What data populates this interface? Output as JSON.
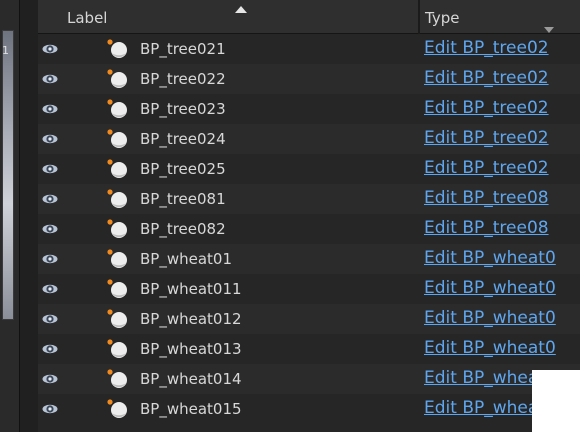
{
  "header": {
    "label_col": "Label",
    "type_col": "Type"
  },
  "left_strip_text": "1",
  "rows": [
    {
      "label": "BP_tree021",
      "type": "Edit BP_tree02"
    },
    {
      "label": "BP_tree022",
      "type": "Edit BP_tree02"
    },
    {
      "label": "BP_tree023",
      "type": "Edit BP_tree02"
    },
    {
      "label": "BP_tree024",
      "type": "Edit BP_tree02"
    },
    {
      "label": "BP_tree025",
      "type": "Edit BP_tree02"
    },
    {
      "label": "BP_tree081",
      "type": "Edit BP_tree08"
    },
    {
      "label": "BP_tree082",
      "type": "Edit BP_tree08"
    },
    {
      "label": "BP_wheat01",
      "type": "Edit BP_wheat0"
    },
    {
      "label": "BP_wheat011",
      "type": "Edit BP_wheat0"
    },
    {
      "label": "BP_wheat012",
      "type": "Edit BP_wheat0"
    },
    {
      "label": "BP_wheat013",
      "type": "Edit BP_wheat0"
    },
    {
      "label": "BP_wheat014",
      "type": "Edit BP_wheat0"
    },
    {
      "label": "BP_wheat015",
      "type": "Edit BP_wheat0"
    }
  ],
  "colors": {
    "link": "#5fa6ee",
    "text": "#d8d8d8",
    "background": "#242424"
  },
  "icons": {
    "visibility": "eye-icon",
    "actor": "actor-sphere-icon",
    "sort": "sort-ascending-icon",
    "column_menu": "chevron-down-icon"
  }
}
